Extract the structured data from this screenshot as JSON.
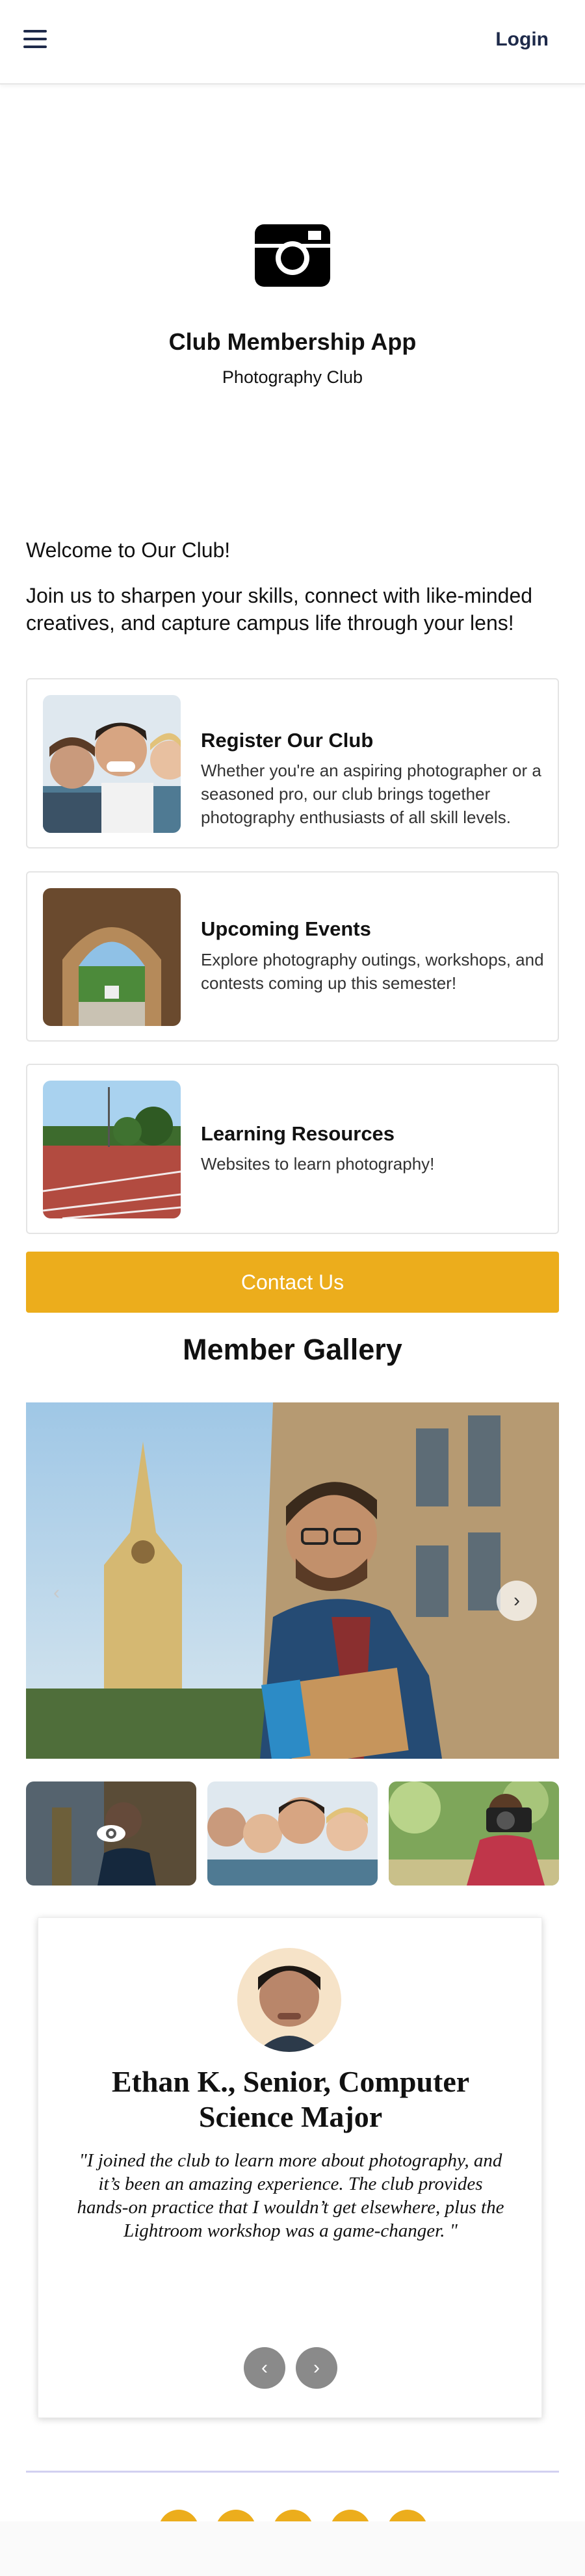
{
  "header": {
    "login_label": "Login"
  },
  "hero": {
    "title": "Club Membership App",
    "subtitle": "Photography Club"
  },
  "welcome": {
    "heading": "Welcome to Our Club!",
    "intro": "Join us to sharpen your skills, connect with like-minded creatives, and capture campus life through your lens!"
  },
  "cards": [
    {
      "title": "Register Our Club",
      "description": "Whether you're an aspiring photographer or a seasoned pro, our club brings together photography enthusiasts of all skill levels."
    },
    {
      "title": "Upcoming Events",
      "description": "Explore photography outings, workshops, and contests coming up this semester!"
    },
    {
      "title": "Learning Resources",
      "description": "Websites to learn photography!"
    }
  ],
  "contact_label": "Contact Us",
  "gallery": {
    "title": "Member Gallery",
    "prev_icon": "‹",
    "next_icon": "›"
  },
  "testimonial": {
    "name": "Ethan K., Senior, Computer Science Major",
    "quote": "\"I joined the club to learn more about photography, and it’s been an amazing experience. The club provides hands-on practice that I wouldn’t get elsewhere, plus the Lightroom workshop was a game-changer. \"",
    "prev_icon": "‹",
    "next_icon": "›"
  },
  "colors": {
    "accent": "#ECAD1C",
    "navy": "#1E2A4A",
    "divider": "#D2D0F0"
  }
}
